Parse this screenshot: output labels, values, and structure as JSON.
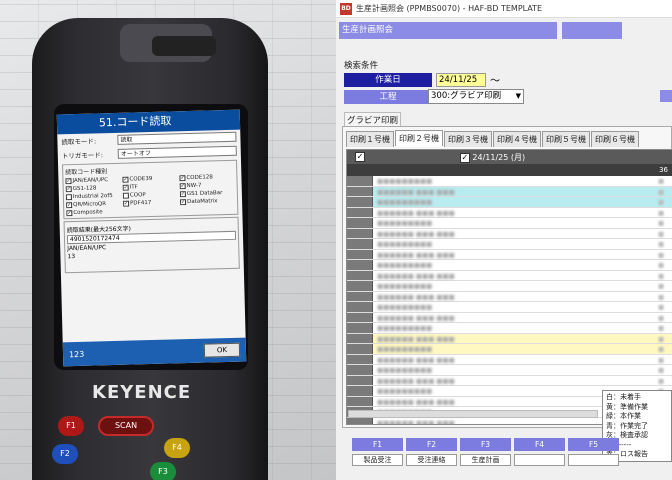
{
  "photo": {
    "screen_title": "51.コード読取",
    "read_mode_label": "読取モード:",
    "read_mode_value": "読取",
    "trigger_mode_label": "トリガモード:",
    "trigger_mode_value": "オートオフ",
    "read_count_label": "読取コード種別",
    "code_label": "コード種別:",
    "codes": [
      {
        "name": "JAN/EAN/UPC",
        "checked": true
      },
      {
        "name": "CODE39",
        "checked": true
      },
      {
        "name": "CODE128",
        "checked": true
      },
      {
        "name": "GS1-128",
        "checked": true
      },
      {
        "name": "ITF",
        "checked": true
      },
      {
        "name": "NW-7",
        "checked": true
      },
      {
        "name": "Industrial 2of5",
        "checked": false
      },
      {
        "name": "COOP",
        "checked": false
      },
      {
        "name": "GS1 DataBar",
        "checked": true
      },
      {
        "name": "QR/MicroQR",
        "checked": true
      },
      {
        "name": "PDF417",
        "checked": true
      },
      {
        "name": "DataMatrix",
        "checked": true
      }
    ],
    "composite": "Composite",
    "result_title": "読取結果(最大256文字)",
    "result_value": "4901520172474",
    "result_type": "JAN/EAN/UPC",
    "result_len": "13",
    "ok_label": "OK",
    "badge": "123",
    "brand": "KEYENCE",
    "keys": {
      "f1": "F1",
      "scan": "SCAN",
      "f2": "F2",
      "f3": "F3",
      "f4": "F4"
    }
  },
  "window": {
    "title": "生産計画照会 (PPMBS0070) - HAF-BD TEMPLATE",
    "header": "生産計画照会",
    "search_conditions": "検索条件",
    "work_date_label": "作業日",
    "work_date_value": "24/11/25",
    "tilde": "〜",
    "process_label": "工程",
    "process_value": "300:グラビア印刷",
    "group_tab": "グラビア印刷",
    "tabs": [
      "印刷１号機",
      "印刷２号機",
      "印刷３号機",
      "印刷４号機",
      "印刷５号機",
      "印刷６号機"
    ],
    "active_tab": 1,
    "grid_date": "24/11/25 (月)",
    "grid_sub": "36",
    "legend": [
      "白：未着手",
      "黄：準備作業",
      "緑：本作業",
      "青：作業完了",
      "灰：検査承認",
      "----------",
      "赤：ロス報告"
    ],
    "fkeys": [
      "F1",
      "F2",
      "F3",
      "F4",
      "F5"
    ],
    "fkey_labels": [
      "製品受注",
      "受注連絡",
      "生産計画",
      "",
      ""
    ]
  },
  "colors": {
    "header_blue": "#8c8ce6",
    "date_label_blue": "#1e1ea0",
    "date_highlight": "#ffff99",
    "row_cyan": "#b8ecf0",
    "row_yellow": "#fff8c0"
  }
}
